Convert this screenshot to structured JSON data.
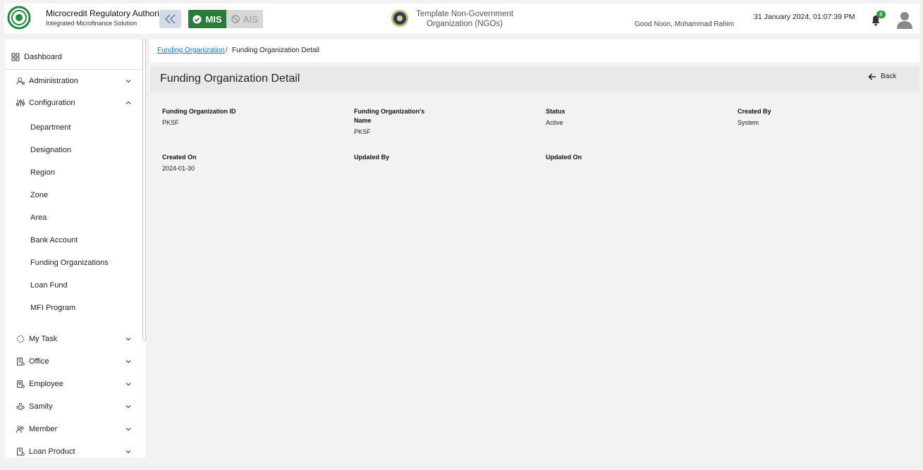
{
  "header": {
    "org_title": "Microcredit Regulatory Authority",
    "org_subtitle": "Integrated Microfinance Solution",
    "mis_label": "MIS",
    "ais_label": "AIS",
    "ngo_name": "Template Non-Government Organization (NGOs)",
    "greeting": "Good Noon, Mohammad Rahim",
    "datetime": "31 January 2024, 01:07:39 PM",
    "notification_count": "8",
    "accent_color": "#2c7a3a"
  },
  "sidebar": {
    "dashboard": "Dashboard",
    "administration": "Administration",
    "configuration": "Configuration",
    "config_items": [
      "Department",
      "Designation",
      "Region",
      "Zone",
      "Area",
      "Bank Account",
      "Funding Organizations",
      "Loan Fund",
      "MFI Program"
    ],
    "my_task": "My Task",
    "office": "Office",
    "employee": "Employee",
    "samity": "Samity",
    "member": "Member",
    "loan_product": "Loan Product"
  },
  "breadcrumb": {
    "parent": "Funding Organization",
    "separator": "/",
    "current": "Funding Organization Detail"
  },
  "page": {
    "title": "Funding Organization Detail",
    "back_label": "Back"
  },
  "fields": {
    "id_label": "Funding Organization ID",
    "id_value": "PKSF",
    "name_label_1": "Funding Organization's",
    "name_label_2": "Name",
    "name_value": "PKSF",
    "status_label": "Status",
    "status_value": "Active",
    "created_by_label": "Created By",
    "created_by_value": "System",
    "created_on_label": "Created On",
    "created_on_value": "2024-01-30",
    "updated_by_label": "Updated By",
    "updated_on_label": "Updated On"
  }
}
